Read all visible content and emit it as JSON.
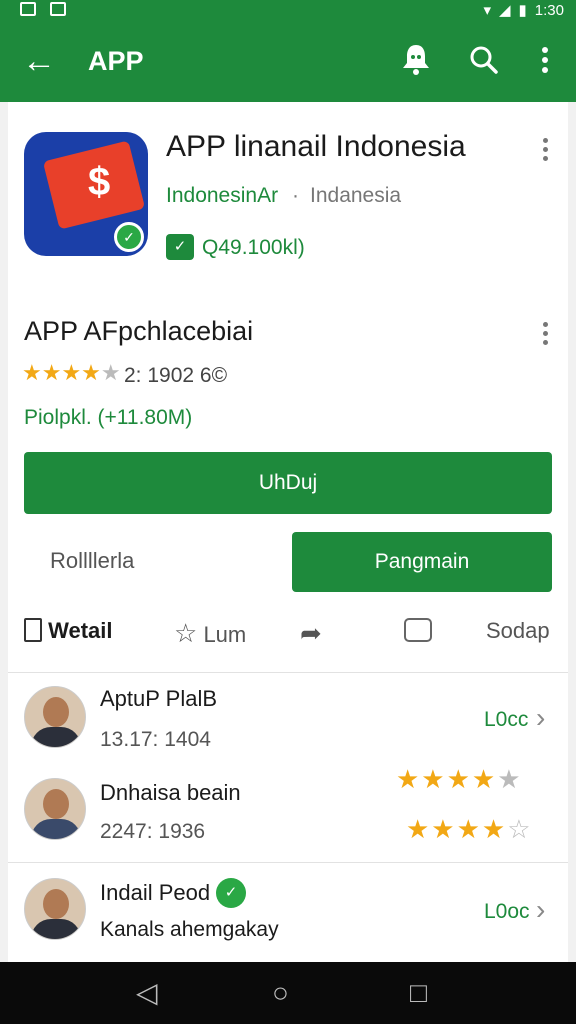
{
  "status": {
    "time": "1:30"
  },
  "app_bar": {
    "title": "APP"
  },
  "app": {
    "name": "APP linanail Indonesia",
    "developer": "IndonesinAr",
    "separator": "·",
    "region": "Indanesia",
    "price_icon": "check-badge-icon",
    "price": "Q49.100kl)"
  },
  "details": {
    "name": "APP AFpchlacebiai",
    "rating_stars": 4,
    "rating_text": "2: 1902 6©",
    "downloads": "Piolpkl. (+11.80M)"
  },
  "buttons": {
    "install": "UhDuj",
    "secondary": "Rollllerla",
    "primary": "Pangmain"
  },
  "tabs": [
    {
      "label": "Wetail",
      "icon": "document-icon"
    },
    {
      "label": "Lum",
      "icon": "star-icon"
    },
    {
      "label": "",
      "icon": "share-icon"
    },
    {
      "label": "",
      "icon": "chat-icon"
    },
    {
      "label": "Sodap",
      "icon": ""
    }
  ],
  "reviews": [
    {
      "name": "AptuP PlalB",
      "meta": "13.17: 1404",
      "action": "L0cc",
      "stars": null
    },
    {
      "name": "Dnhaisa beain",
      "meta": "2247: 1936",
      "action": "",
      "stars": [
        4,
        4
      ]
    },
    {
      "name": "Indail Peod",
      "meta": "Kanals ahemgakay",
      "action": "L0oc",
      "stars": null,
      "verified": true
    }
  ]
}
